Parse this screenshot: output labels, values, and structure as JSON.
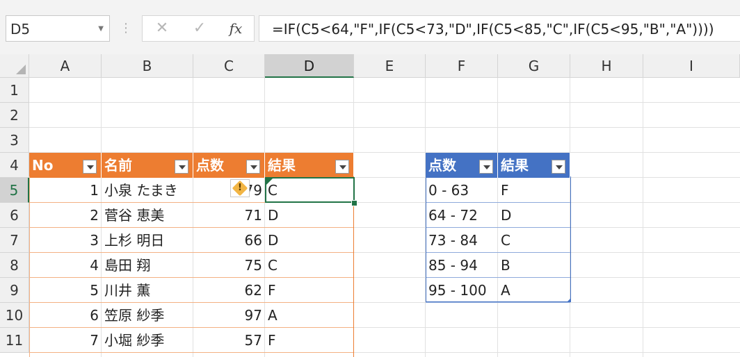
{
  "formula_bar": {
    "name_box": "D5",
    "cancel_icon": "✕",
    "enter_icon": "✓",
    "fx_label": "fx",
    "formula": "=IF(C5<64,\"F\",IF(C5<73,\"D\",IF(C5<85,\"C\",IF(C5<95,\"B\",\"A\"))))"
  },
  "columns": [
    "A",
    "B",
    "C",
    "D",
    "E",
    "F",
    "G",
    "H",
    "I"
  ],
  "rows": [
    "1",
    "2",
    "3",
    "4",
    "5",
    "6",
    "7",
    "8",
    "9",
    "10",
    "11"
  ],
  "selected_cell": "D5",
  "table1": {
    "headers": [
      "No",
      "名前",
      "点数",
      "結果"
    ],
    "rows": [
      [
        "1",
        "小泉 たまき",
        "79",
        "C"
      ],
      [
        "2",
        "菅谷 恵美",
        "71",
        "D"
      ],
      [
        "3",
        "上杉 明日",
        "66",
        "D"
      ],
      [
        "4",
        "島田 翔",
        "75",
        "C"
      ],
      [
        "5",
        "川井 薫",
        "62",
        "F"
      ],
      [
        "6",
        "笠原 紗季",
        "97",
        "A"
      ],
      [
        "7",
        "小堀 紗季",
        "57",
        "F"
      ]
    ]
  },
  "table2": {
    "headers": [
      "点数",
      "結果"
    ],
    "rows": [
      [
        "0 - 63",
        "F"
      ],
      [
        "64 - 72",
        "D"
      ],
      [
        "73 - 84",
        "C"
      ],
      [
        "85 - 94",
        "B"
      ],
      [
        "95 - 100",
        "A"
      ]
    ]
  },
  "error_indicator": "!",
  "colors": {
    "table1_header": "#ed7d31",
    "table2_header": "#4472c4",
    "selection": "#217346"
  }
}
